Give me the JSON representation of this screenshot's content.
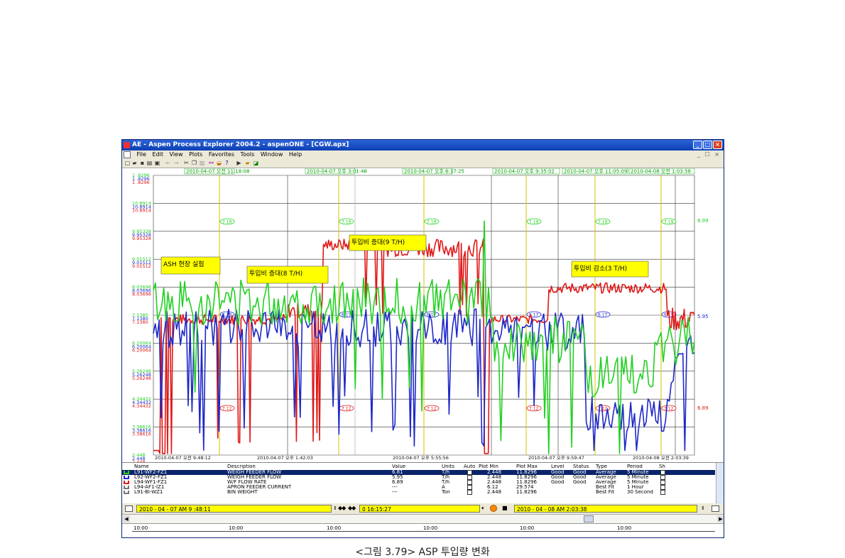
{
  "window": {
    "title": "AE - Aspen Process Explorer 2004.2 - aspenONE - [CGW.apx]",
    "controls": [
      "_",
      "□",
      "×"
    ],
    "doc_controls": "_ ☐ ×"
  },
  "menu": [
    "File",
    "Edit",
    "View",
    "Plots",
    "Favorites",
    "Tools",
    "Window",
    "Help"
  ],
  "toolbar_icons": [
    "new-icon",
    "open-icon",
    "save-icon",
    "print-icon",
    "print-preview-icon",
    "back-icon",
    "forward-icon",
    "cut-icon",
    "copy-icon",
    "paste-icon",
    "binoculars-icon",
    "palette-icon",
    "help-icon",
    "play-icon",
    "folder-icon",
    "chart-icon"
  ],
  "plot": {
    "top_timestamps": [
      "2010-04-07 오전 11:18:08",
      "2010-04-07 오후 3:01:46",
      "2010-04-07 오후 6:17:25",
      "2010-04-07 오후 9:35:02",
      "2010-04-07 오후 11:05:09",
      "2010-04-08 오전 1:03:58"
    ],
    "bottom_timestamps": [
      "2010-04-07 오전 9:48:12",
      "2010-04-07 오후 1:42:03",
      "2010-04-07 오후 5:55:56",
      "2010-04-07 오후 9:59:47",
      "2010-04-08 오전 2:03:39"
    ],
    "y_labels": {
      "green": [
        "1 .8296",
        "10.8914",
        "9.95328",
        "9.01512",
        "8.03696",
        "7.1380",
        "6.20064",
        "5.26248",
        "4.34432",
        "3.38616",
        "2.448"
      ],
      "blue": [
        "1 .8296",
        "10.8914",
        "9.95328",
        "9.01512",
        "8.03696",
        "7.1380",
        "6.20064",
        "5.26248",
        "4.34432",
        "3.38616",
        "2.448"
      ],
      "red": [
        "1 .8296",
        "10.8914",
        "9.95328",
        "9.01512",
        "8.03696",
        "7.1380",
        "6.20064",
        "5.26248",
        "4.34432",
        "3.38616",
        "2.448"
      ]
    },
    "right_values": {
      "green": "6.99",
      "blue": "5.95",
      "red": "6.89"
    },
    "cursor_values": {
      "green": "7.19",
      "blue": "6.17",
      "red": "7.12"
    },
    "annotations": [
      "ASH 현장 실험",
      "투입비 증대(8 T/H)",
      "투입비 증대(9 T/H)",
      "투입비 감소(3 T/H)"
    ],
    "colors": {
      "green": "#22d022",
      "blue": "#1e28c8",
      "red": "#e01818",
      "cursor": "#d4c200",
      "timestamp": "#00a000"
    }
  },
  "legend": {
    "headers": [
      "Name",
      "Description",
      "Value",
      "Units",
      "Auto",
      "Plot Min",
      "Plot Max",
      "Level",
      "Status",
      "Type",
      "Period",
      "Sh"
    ],
    "rows": [
      {
        "name": "L91-WF2-FZ1",
        "description": "WEIGH FEEDER FLOW",
        "value": "6.81",
        "units": "T/h",
        "min": "2.448",
        "max": "11.8296",
        "level": "Good",
        "status": "Good",
        "type": "Average",
        "period": "5 Minute",
        "color": "#22d022",
        "selected": true
      },
      {
        "name": "L92-WF2-FZ1",
        "description": "WEIGH FEEDER FLOW",
        "value": "5.95",
        "units": "T/h",
        "min": "2.448",
        "max": "11.8296",
        "level": "Good",
        "status": "Good",
        "type": "Average",
        "period": "5 Minute",
        "color": "#1e28c8",
        "selected": false
      },
      {
        "name": "L94-WF1-FZ1",
        "description": "W/F FLOW RATE",
        "value": "6.89",
        "units": "T/h",
        "min": "2.448",
        "max": "11.8296",
        "level": "Good",
        "status": "Good",
        "type": "Average",
        "period": "5 Minute",
        "color": "#e01818",
        "selected": false
      },
      {
        "name": "L94-AF1-IZ1",
        "description": "APRON FEEDER CURRENT",
        "value": "---",
        "units": "A",
        "min": "6.12",
        "max": "29.574",
        "level": "",
        "status": "",
        "type": "Best Fit",
        "period": "1 Hour",
        "color": "#777777",
        "selected": false
      },
      {
        "name": "L91-BI-WZ1",
        "description": "BIN WEIGHT",
        "value": "---",
        "units": "Ton",
        "min": "2.448",
        "max": "11.8296",
        "level": "",
        "status": "",
        "type": "Best Fit",
        "period": "30 Second",
        "color": "#777777",
        "selected": false
      }
    ]
  },
  "timebar": {
    "start": "2010 - 04 - 07  AM 9 :48:11",
    "duration": "0 16:15:27",
    "end": "2010 - 04 - 08  AM 2:03:38"
  },
  "ruler_labels": [
    "10:00",
    "10:00",
    "10:00",
    "10:00",
    "10:00",
    "10:00"
  ],
  "caption": "<그림 3.79> ASP 투입량 변화"
}
